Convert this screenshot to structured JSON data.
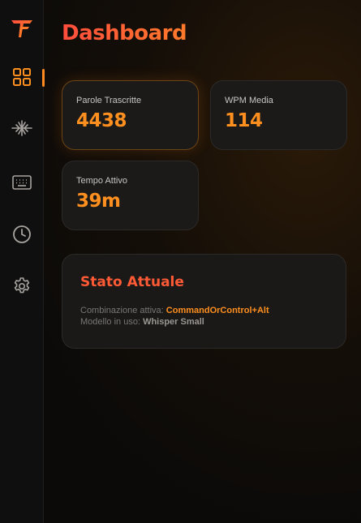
{
  "sidebar": {
    "logo_letters": "TF",
    "items": [
      {
        "name": "dashboard",
        "icon": "grid-icon",
        "active": true
      },
      {
        "name": "transcription",
        "icon": "signal-cross-icon",
        "active": false
      },
      {
        "name": "shortcuts",
        "icon": "keyboard-icon",
        "active": false
      },
      {
        "name": "history",
        "icon": "clock-icon",
        "active": false
      },
      {
        "name": "settings",
        "icon": "gear-icon",
        "active": false
      }
    ]
  },
  "page": {
    "title": "Dashboard"
  },
  "stats": [
    {
      "label": "Parole Trascritte",
      "value": "4438"
    },
    {
      "label": "WPM Media",
      "value": "114"
    },
    {
      "label": "Tempo Attivo",
      "value": "39m"
    }
  ],
  "status": {
    "title": "Stato Attuale",
    "combo_label": "Combinazione attiva:",
    "combo_value": "CommandOrControl+Alt",
    "model_label": "Modello in uso:",
    "model_value": "Whisper Small"
  },
  "colors": {
    "accent": "#ff8f1f",
    "title_red": "#ff5a36",
    "card_bg": "#1b1a19",
    "sidebar_bg": "#0f0f0f"
  }
}
